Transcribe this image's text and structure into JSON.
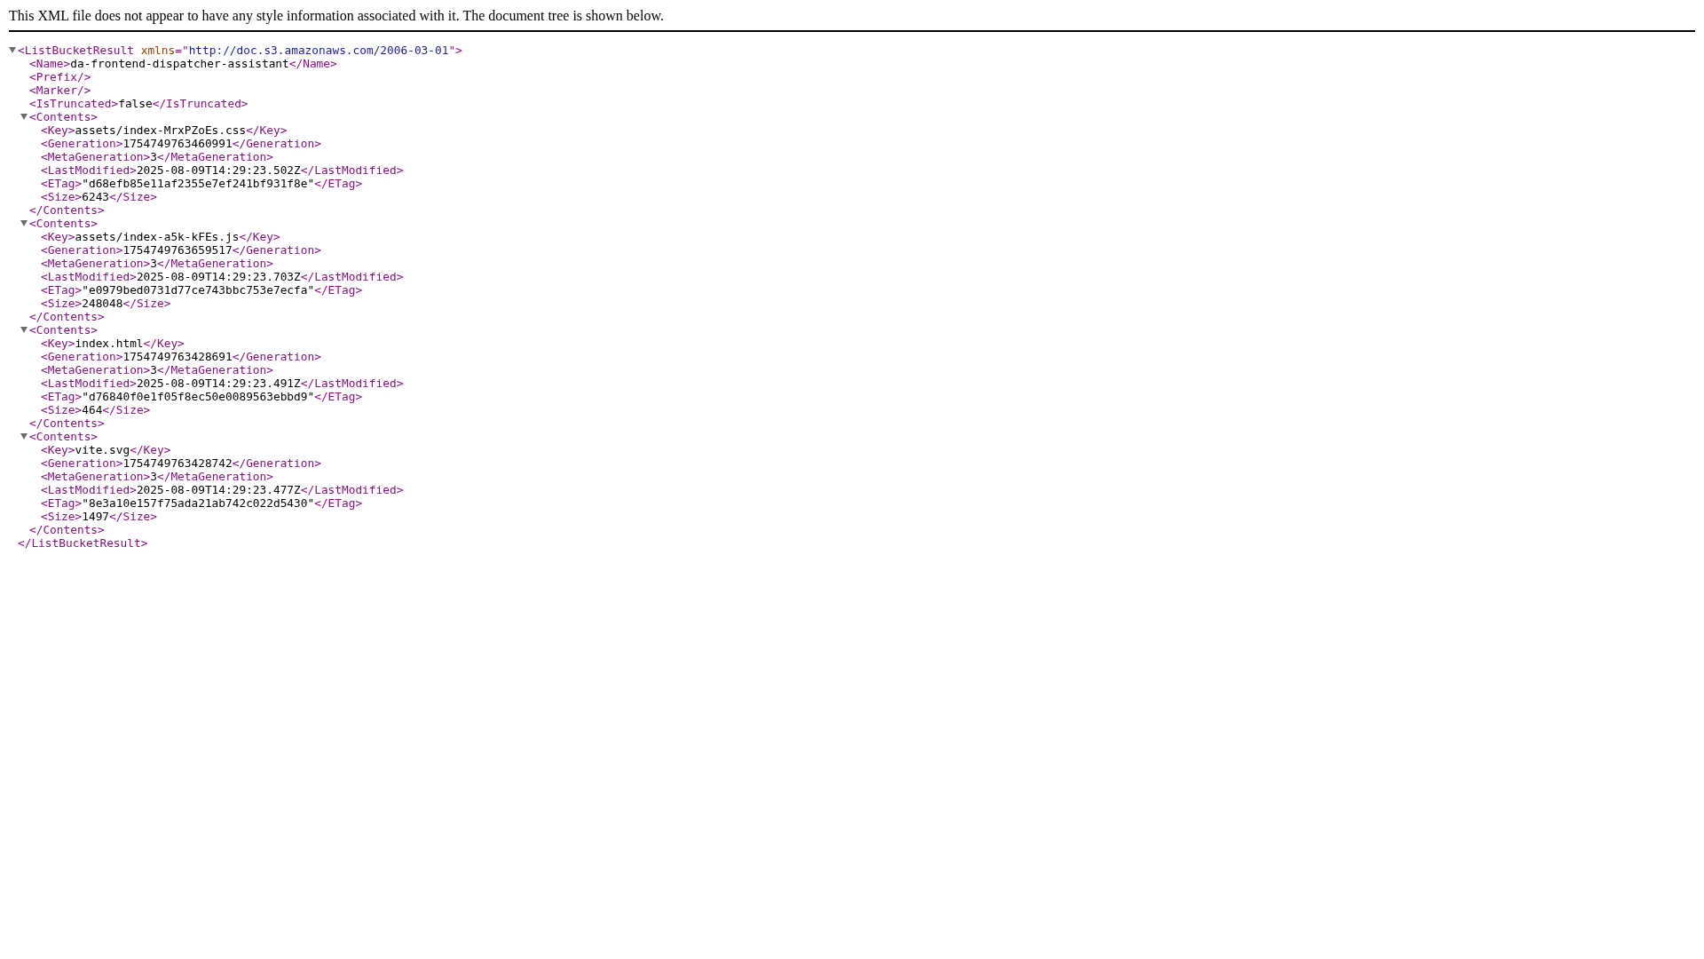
{
  "message": "This XML file does not appear to have any style information associated with it. The document tree is shown below.",
  "tree": {
    "expanded": true,
    "open": [
      {
        "kind": "tag",
        "text": "<ListBucketResult "
      },
      {
        "kind": "attr",
        "text": "xmlns"
      },
      {
        "kind": "tag",
        "text": "=\""
      },
      {
        "kind": "value",
        "text": "http://doc.s3.amazonaws.com/2006-03-01"
      },
      {
        "kind": "tag",
        "text": "\">"
      }
    ],
    "close": [
      {
        "kind": "tag",
        "text": "</ListBucketResult>"
      }
    ],
    "children": [
      {
        "line": [
          {
            "kind": "tag",
            "text": "<Name>"
          },
          {
            "kind": "text",
            "text": "da-frontend-dispatcher-assistant"
          },
          {
            "kind": "tag",
            "text": "</Name>"
          }
        ]
      },
      {
        "line": [
          {
            "kind": "tag",
            "text": "<Prefix/>"
          }
        ]
      },
      {
        "line": [
          {
            "kind": "tag",
            "text": "<Marker/>"
          }
        ]
      },
      {
        "line": [
          {
            "kind": "tag",
            "text": "<IsTruncated>"
          },
          {
            "kind": "text",
            "text": "false"
          },
          {
            "kind": "tag",
            "text": "</IsTruncated>"
          }
        ]
      },
      {
        "expanded": true,
        "open": [
          {
            "kind": "tag",
            "text": "<Contents>"
          }
        ],
        "close": [
          {
            "kind": "tag",
            "text": "</Contents>"
          }
        ],
        "children": [
          {
            "line": [
              {
                "kind": "tag",
                "text": "<Key>"
              },
              {
                "kind": "text",
                "text": "assets/index-MrxPZoEs.css"
              },
              {
                "kind": "tag",
                "text": "</Key>"
              }
            ]
          },
          {
            "line": [
              {
                "kind": "tag",
                "text": "<Generation>"
              },
              {
                "kind": "text",
                "text": "1754749763460991"
              },
              {
                "kind": "tag",
                "text": "</Generation>"
              }
            ]
          },
          {
            "line": [
              {
                "kind": "tag",
                "text": "<MetaGeneration>"
              },
              {
                "kind": "text",
                "text": "3"
              },
              {
                "kind": "tag",
                "text": "</MetaGeneration>"
              }
            ]
          },
          {
            "line": [
              {
                "kind": "tag",
                "text": "<LastModified>"
              },
              {
                "kind": "text",
                "text": "2025-08-09T14:29:23.502Z"
              },
              {
                "kind": "tag",
                "text": "</LastModified>"
              }
            ]
          },
          {
            "line": [
              {
                "kind": "tag",
                "text": "<ETag>"
              },
              {
                "kind": "text",
                "text": "\"d68efb85e11af2355e7ef241bf931f8e\""
              },
              {
                "kind": "tag",
                "text": "</ETag>"
              }
            ]
          },
          {
            "line": [
              {
                "kind": "tag",
                "text": "<Size>"
              },
              {
                "kind": "text",
                "text": "6243"
              },
              {
                "kind": "tag",
                "text": "</Size>"
              }
            ]
          }
        ]
      },
      {
        "expanded": true,
        "open": [
          {
            "kind": "tag",
            "text": "<Contents>"
          }
        ],
        "close": [
          {
            "kind": "tag",
            "text": "</Contents>"
          }
        ],
        "children": [
          {
            "line": [
              {
                "kind": "tag",
                "text": "<Key>"
              },
              {
                "kind": "text",
                "text": "assets/index-a5k-kFEs.js"
              },
              {
                "kind": "tag",
                "text": "</Key>"
              }
            ]
          },
          {
            "line": [
              {
                "kind": "tag",
                "text": "<Generation>"
              },
              {
                "kind": "text",
                "text": "1754749763659517"
              },
              {
                "kind": "tag",
                "text": "</Generation>"
              }
            ]
          },
          {
            "line": [
              {
                "kind": "tag",
                "text": "<MetaGeneration>"
              },
              {
                "kind": "text",
                "text": "3"
              },
              {
                "kind": "tag",
                "text": "</MetaGeneration>"
              }
            ]
          },
          {
            "line": [
              {
                "kind": "tag",
                "text": "<LastModified>"
              },
              {
                "kind": "text",
                "text": "2025-08-09T14:29:23.703Z"
              },
              {
                "kind": "tag",
                "text": "</LastModified>"
              }
            ]
          },
          {
            "line": [
              {
                "kind": "tag",
                "text": "<ETag>"
              },
              {
                "kind": "text",
                "text": "\"e0979bed0731d77ce743bbc753e7ecfa\""
              },
              {
                "kind": "tag",
                "text": "</ETag>"
              }
            ]
          },
          {
            "line": [
              {
                "kind": "tag",
                "text": "<Size>"
              },
              {
                "kind": "text",
                "text": "248048"
              },
              {
                "kind": "tag",
                "text": "</Size>"
              }
            ]
          }
        ]
      },
      {
        "expanded": true,
        "open": [
          {
            "kind": "tag",
            "text": "<Contents>"
          }
        ],
        "close": [
          {
            "kind": "tag",
            "text": "</Contents>"
          }
        ],
        "children": [
          {
            "line": [
              {
                "kind": "tag",
                "text": "<Key>"
              },
              {
                "kind": "text",
                "text": "index.html"
              },
              {
                "kind": "tag",
                "text": "</Key>"
              }
            ]
          },
          {
            "line": [
              {
                "kind": "tag",
                "text": "<Generation>"
              },
              {
                "kind": "text",
                "text": "1754749763428691"
              },
              {
                "kind": "tag",
                "text": "</Generation>"
              }
            ]
          },
          {
            "line": [
              {
                "kind": "tag",
                "text": "<MetaGeneration>"
              },
              {
                "kind": "text",
                "text": "3"
              },
              {
                "kind": "tag",
                "text": "</MetaGeneration>"
              }
            ]
          },
          {
            "line": [
              {
                "kind": "tag",
                "text": "<LastModified>"
              },
              {
                "kind": "text",
                "text": "2025-08-09T14:29:23.491Z"
              },
              {
                "kind": "tag",
                "text": "</LastModified>"
              }
            ]
          },
          {
            "line": [
              {
                "kind": "tag",
                "text": "<ETag>"
              },
              {
                "kind": "text",
                "text": "\"d76840f0e1f05f8ec50e0089563ebbd9\""
              },
              {
                "kind": "tag",
                "text": "</ETag>"
              }
            ]
          },
          {
            "line": [
              {
                "kind": "tag",
                "text": "<Size>"
              },
              {
                "kind": "text",
                "text": "464"
              },
              {
                "kind": "tag",
                "text": "</Size>"
              }
            ]
          }
        ]
      },
      {
        "expanded": true,
        "open": [
          {
            "kind": "tag",
            "text": "<Contents>"
          }
        ],
        "close": [
          {
            "kind": "tag",
            "text": "</Contents>"
          }
        ],
        "children": [
          {
            "line": [
              {
                "kind": "tag",
                "text": "<Key>"
              },
              {
                "kind": "text",
                "text": "vite.svg"
              },
              {
                "kind": "tag",
                "text": "</Key>"
              }
            ]
          },
          {
            "line": [
              {
                "kind": "tag",
                "text": "<Generation>"
              },
              {
                "kind": "text",
                "text": "1754749763428742"
              },
              {
                "kind": "tag",
                "text": "</Generation>"
              }
            ]
          },
          {
            "line": [
              {
                "kind": "tag",
                "text": "<MetaGeneration>"
              },
              {
                "kind": "text",
                "text": "3"
              },
              {
                "kind": "tag",
                "text": "</MetaGeneration>"
              }
            ]
          },
          {
            "line": [
              {
                "kind": "tag",
                "text": "<LastModified>"
              },
              {
                "kind": "text",
                "text": "2025-08-09T14:29:23.477Z"
              },
              {
                "kind": "tag",
                "text": "</LastModified>"
              }
            ]
          },
          {
            "line": [
              {
                "kind": "tag",
                "text": "<ETag>"
              },
              {
                "kind": "text",
                "text": "\"8e3a10e157f75ada21ab742c022d5430\""
              },
              {
                "kind": "tag",
                "text": "</ETag>"
              }
            ]
          },
          {
            "line": [
              {
                "kind": "tag",
                "text": "<Size>"
              },
              {
                "kind": "text",
                "text": "1497"
              },
              {
                "kind": "tag",
                "text": "</Size>"
              }
            ]
          }
        ]
      }
    ]
  }
}
